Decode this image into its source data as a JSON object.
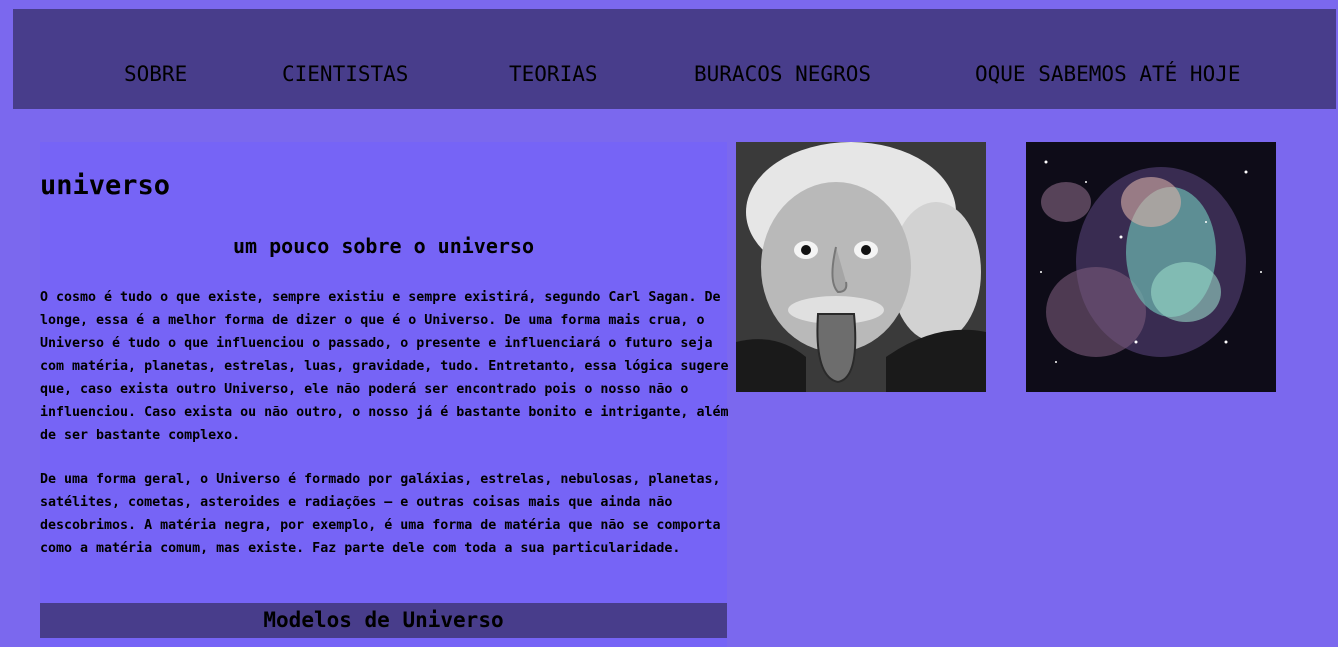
{
  "nav": {
    "items": [
      {
        "label": "SOBRE"
      },
      {
        "label": "CIENTISTAS"
      },
      {
        "label": "TEORIAS"
      },
      {
        "label": "BURACOS NEGROS"
      },
      {
        "label": "OQUE SABEMOS ATÉ HOJE"
      }
    ]
  },
  "main": {
    "title": "universo",
    "subtitle": "um pouco sobre o universo",
    "paragraphs": [
      "O cosmo é tudo o que existe, sempre existiu e sempre existirá, segundo Carl Sagan. De longe, essa é a melhor forma de dizer o que é o Universo. De uma forma mais crua, o Universo é tudo o que influenciou o passado, o presente e influenciará o futuro seja com matéria, planetas, estrelas, luas, gravidade, tudo. Entretanto, essa lógica sugere que, caso exista outro Universo, ele não poderá ser encontrado pois o nosso não o influenciou. Caso exista ou não outro, o nosso já é bastante bonito e intrigante, além de ser bastante complexo.",
      "De uma forma geral, o Universo é formado por galáxias, estrelas, nebulosas, planetas, satélites, cometas, asteroides e radiações – e outras coisas mais que ainda não descobrimos. A matéria negra, por exemplo, é uma forma de matéria que não se comporta como a matéria comum, mas existe. Faz parte dele com toda a sua particularidade."
    ],
    "section_heading": "Modelos de Universo"
  },
  "colors": {
    "page_background": "#7b68ee",
    "navbar_background": "#483d8b",
    "content_background": "#7664f6",
    "text": "#000000"
  },
  "images": [
    {
      "name": "einstein-photo"
    },
    {
      "name": "nebula-photo"
    }
  ]
}
